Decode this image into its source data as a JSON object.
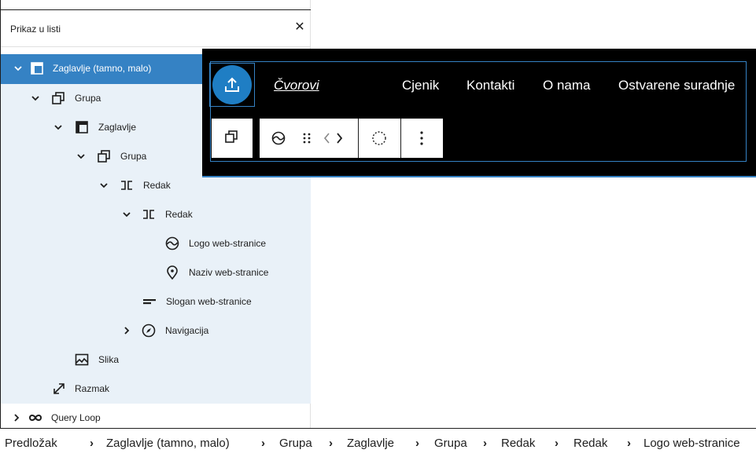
{
  "panel": {
    "title": "Prikaz u listi",
    "close_icon": "close-icon",
    "items": [
      {
        "label": "Zaglavlje (tamno, malo)",
        "icon": "template-part-icon",
        "expanded": true,
        "selected": true
      },
      {
        "label": "Grupa",
        "icon": "group-icon",
        "expanded": true
      },
      {
        "label": "Zaglavlje",
        "icon": "template-part-icon",
        "expanded": true
      },
      {
        "label": "Grupa",
        "icon": "group-icon",
        "expanded": true
      },
      {
        "label": "Redak",
        "icon": "row-icon",
        "expanded": true
      },
      {
        "label": "Redak",
        "icon": "row-icon",
        "expanded": true
      },
      {
        "label": "Logo web-stranice",
        "icon": "site-logo-icon"
      },
      {
        "label": "Naziv web-stranice",
        "icon": "map-marker-icon"
      },
      {
        "label": "Slogan web-stranice",
        "icon": "tagline-icon"
      },
      {
        "label": "Navigacija",
        "icon": "navigation-icon",
        "expanded": false
      },
      {
        "label": "Slika",
        "icon": "image-icon"
      },
      {
        "label": "Razmak",
        "icon": "resize-icon"
      },
      {
        "label": "Query Loop",
        "icon": "loop-icon",
        "expanded": false
      }
    ]
  },
  "preview": {
    "site_title": "Čvorovi",
    "nav": [
      "Cjenik",
      "Kontakti",
      "O nama",
      "Ostvarene suradnje"
    ],
    "logo_icon": "upload-icon",
    "toolbar_icons": [
      "group-icon",
      "site-logo-icon",
      "drag-handle-icon",
      "chevron-left-icon",
      "chevron-right-icon",
      "dashed-circle-icon",
      "more-vertical-icon"
    ]
  },
  "breadcrumb": [
    "Predložak",
    "Zaglavlje (tamno, malo)",
    "Grupa",
    "Zaglavlje",
    "Grupa",
    "Redak",
    "Redak",
    "Logo web-stranice"
  ],
  "colors": {
    "accent": "#3582c4",
    "accent_light": "#e9f1f8",
    "logo_bg": "#1f7ec4",
    "dark": "#000000"
  }
}
